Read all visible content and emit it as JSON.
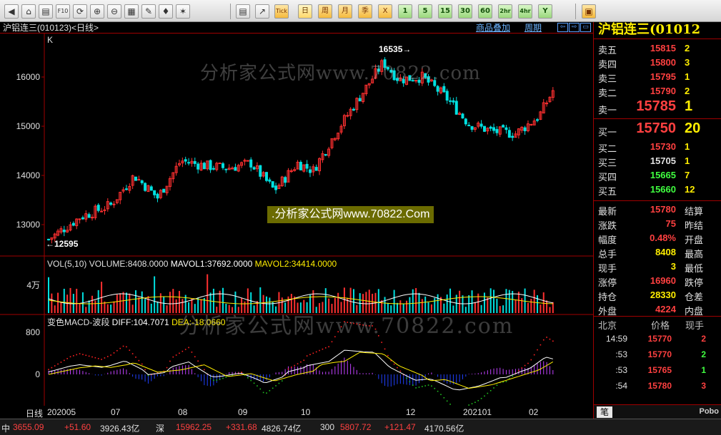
{
  "toolbar": {
    "icons": [
      {
        "id": "prev",
        "glyph": "◀"
      },
      {
        "id": "home",
        "glyph": "⌂"
      },
      {
        "id": "doc",
        "glyph": "▤"
      },
      {
        "id": "f10",
        "glyph": "F10"
      },
      {
        "id": "refresh",
        "glyph": "⟳"
      },
      {
        "id": "zoom-in",
        "glyph": "⊕"
      },
      {
        "id": "zoom-out",
        "glyph": "⊖"
      },
      {
        "id": "chart-type",
        "glyph": "▦"
      },
      {
        "id": "draw",
        "glyph": "✎"
      },
      {
        "id": "alert",
        "glyph": "♦"
      },
      {
        "id": "new",
        "glyph": "✶"
      }
    ],
    "view_icons": [
      {
        "id": "quote-list",
        "glyph": "▤"
      },
      {
        "id": "trend",
        "glyph": "↗"
      },
      {
        "id": "tick",
        "glyph": "Tick"
      }
    ],
    "periods": [
      "日",
      "周",
      "月",
      "季",
      "X",
      "1",
      "5",
      "15",
      "30",
      "60",
      "2hr",
      "4hr",
      "Y"
    ],
    "selected_period": "日",
    "last_icon": "▣"
  },
  "chart": {
    "title": "沪铝连三(010123)<日线>",
    "link_add": "商品叠加",
    "link_period": "周期",
    "k_label": "K",
    "price_ticks": [
      "16000",
      "15000",
      "14000",
      "13000"
    ],
    "high_label": "16535",
    "low_label": "12595",
    "vol_indicator": {
      "name": "VOL(5,10)",
      "volume": "VOLUME:8408.0000",
      "mavol1": "MAVOL1:37692.0000",
      "mavol2": "MAVOL2:34414.0000",
      "tick": "4万"
    },
    "macd_indicator": {
      "name": "变色MACD-波段",
      "diff": "DIFF:104.7071",
      "dea": "DEA:-18.0660",
      "ticks": [
        "800",
        "0"
      ]
    },
    "date_axis": {
      "period_label": "日线",
      "labels": [
        "202005",
        "07",
        "08",
        "09",
        "10",
        "12",
        "202101",
        "02"
      ]
    }
  },
  "panel": {
    "stock_name": "沪铝连三(01012",
    "asks": [
      {
        "label": "卖五",
        "price": "15815",
        "vol": "2"
      },
      {
        "label": "卖四",
        "price": "15800",
        "vol": "3"
      },
      {
        "label": "卖三",
        "price": "15795",
        "vol": "1"
      },
      {
        "label": "卖二",
        "price": "15790",
        "vol": "2"
      },
      {
        "label": "卖一",
        "price": "15785",
        "vol": "1"
      }
    ],
    "bids": [
      {
        "label": "买一",
        "price": "15750",
        "vol": "20"
      },
      {
        "label": "买二",
        "price": "15730",
        "vol": "1"
      },
      {
        "label": "买三",
        "price": "15705",
        "vol": "1"
      },
      {
        "label": "买四",
        "price": "15665",
        "vol": "7"
      },
      {
        "label": "买五",
        "price": "15660",
        "vol": "12"
      }
    ],
    "stats": [
      {
        "label": "最新",
        "value": "15780",
        "right": "结算",
        "color": "#ff4040"
      },
      {
        "label": "涨跌",
        "value": "75",
        "right": "昨结",
        "color": "#ff4040"
      },
      {
        "label": "幅度",
        "value": "0.48%",
        "right": "开盘",
        "color": "#ff4040"
      },
      {
        "label": "总手",
        "value": "8408",
        "right": "最高",
        "color": "#ffee00"
      },
      {
        "label": "现手",
        "value": "3",
        "right": "最低",
        "color": "#ffee00"
      },
      {
        "label": "涨停",
        "value": "16960",
        "right": "跌停",
        "color": "#ff4040"
      },
      {
        "label": "持仓",
        "value": "28330",
        "right": "仓差",
        "color": "#ffee00"
      },
      {
        "label": "外盘",
        "value": "4224",
        "right": "内盘",
        "color": "#ff4040"
      }
    ],
    "tick_header": {
      "place": "北京",
      "price": "价格",
      "vol": "现手"
    },
    "ticks": [
      {
        "time": "14:59",
        "price": "15770",
        "vol": "2",
        "vol_color": "#ff4040"
      },
      {
        "time": ":53",
        "price": "15770",
        "vol": "2",
        "vol_color": "#40ff40"
      },
      {
        "time": ":53",
        "price": "15765",
        "vol": "1",
        "vol_color": "#40ff40"
      },
      {
        "time": ":54",
        "price": "15780",
        "vol": "3",
        "vol_color": "#ff4040"
      }
    ],
    "bottom_tab": "笔",
    "brand": "Pobo"
  },
  "status": [
    {
      "text": "中",
      "color": "#e0e0e0"
    },
    {
      "text": "3655.09",
      "color": "#ff4040"
    },
    {
      "text": "+51.60",
      "color": "#ff4040"
    },
    {
      "text": "3926.43亿",
      "color": "#e0e0e0"
    },
    {
      "text": "深",
      "color": "#e0e0e0"
    },
    {
      "text": "15962.25",
      "color": "#ff4040"
    },
    {
      "text": "+331.68",
      "color": "#ff4040"
    },
    {
      "text": "4826.74亿",
      "color": "#e0e0e0"
    },
    {
      "text": "300",
      "color": "#e0e0e0"
    },
    {
      "text": "5807.72",
      "color": "#ff4040"
    },
    {
      "text": "+121.47",
      "color": "#ff4040"
    },
    {
      "text": "4170.56亿",
      "color": "#e0e0e0"
    }
  ],
  "watermarks": {
    "top": "分析家公式网www.70822.com",
    "mid": ".分析家公式网www.70822.Com",
    "bottom": "分析家公式网www.70822.com"
  },
  "colors": {
    "up": "#ff3030",
    "down": "#00e0e0",
    "ma1": "#ffffff",
    "ma2": "#ffee00",
    "macd_up": "#ff2020",
    "macd_down": "#20c020",
    "grid": "#a00000"
  }
}
